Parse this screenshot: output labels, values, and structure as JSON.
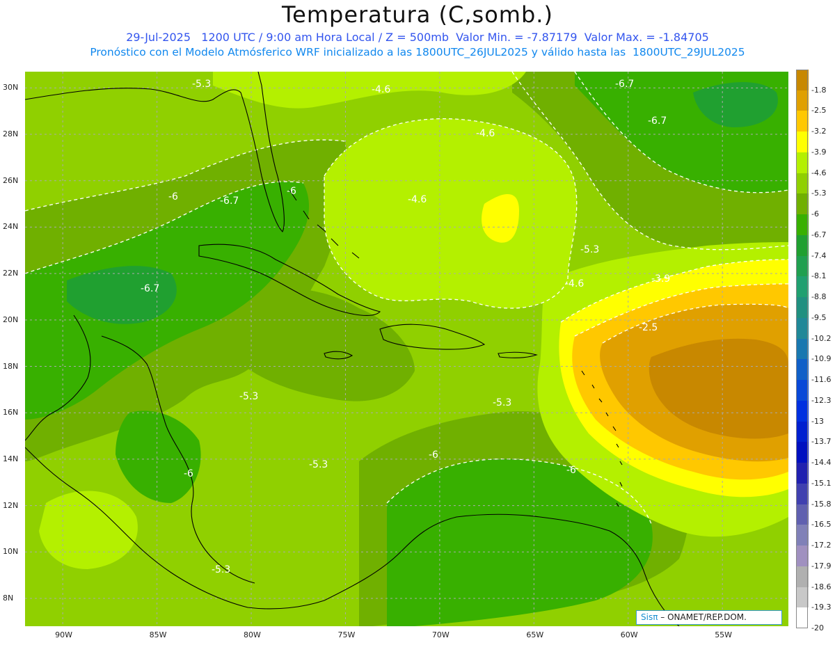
{
  "header": {
    "title": "Temperatura (C,somb.)",
    "subtitle_line1": "29-Jul-2025   1200 UTC / 9:00 am Hora Local / Z = 500mb  Valor Min. = -7.87179  Valor Max. = -1.84705",
    "subtitle_line2": "Pronóstico con el Modelo Atmósferico WRF inicializado a las 1800UTC_26JUL2025 y válido hasta las  1800UTC_29JUL2025"
  },
  "map": {
    "lon_range": [
      -92,
      -51.5
    ],
    "lat_range": [
      6.8,
      30.7
    ],
    "lat_ticks": [
      "30N",
      "28N",
      "26N",
      "24N",
      "22N",
      "20N",
      "18N",
      "16N",
      "14N",
      "12N",
      "10N",
      "8N"
    ],
    "lat_values": [
      30,
      28,
      26,
      24,
      22,
      20,
      18,
      16,
      14,
      12,
      10,
      8
    ],
    "lon_ticks": [
      "90W",
      "85W",
      "80W",
      "75W",
      "70W",
      "65W",
      "60W",
      "55W"
    ],
    "lon_values": [
      -90,
      -85,
      -80,
      -75,
      -70,
      -65,
      -60,
      -55
    ],
    "contour_labels": [
      "-5.3",
      "-4.6",
      "-6.7",
      "-6.7",
      "-4.6",
      "-6",
      "-6.7",
      "-6",
      "-4.6",
      "-5.3",
      "-6.7",
      "-4.6",
      "-3.9",
      "-2.5",
      "-5.3",
      "-5.3",
      "-6",
      "-6",
      "-5.3",
      "-6",
      "-5.3"
    ],
    "gridlines": true
  },
  "colorbar": {
    "labels": [
      "-1.8",
      "-2.5",
      "-3.2",
      "-3.9",
      "-4.6",
      "-5.3",
      "-6",
      "-6.7",
      "-7.4",
      "-8.1",
      "-8.8",
      "-9.5",
      "-10.2",
      "-10.9",
      "-11.6",
      "-12.3",
      "-13",
      "-13.7",
      "-14.4",
      "-15.1",
      "-15.8",
      "-16.5",
      "-17.2",
      "-17.9",
      "-18.6",
      "-19.3",
      "-20"
    ],
    "colors": [
      "#c88800",
      "#e0a000",
      "#ffc800",
      "#ffff00",
      "#b4f000",
      "#90d000",
      "#70b000",
      "#38b000",
      "#20a030",
      "#20a050",
      "#20a070",
      "#209080",
      "#208898",
      "#1878b0",
      "#1060c8",
      "#0848d8",
      "#0030e0",
      "#0020d0",
      "#0010c0",
      "#2020b0",
      "#4040b0",
      "#6060b0",
      "#8080b8",
      "#a090c0",
      "#b0b0b0",
      "#c8c8c8",
      "#ffffff"
    ]
  },
  "credit": {
    "brand": "Sisπ",
    "text": " – ONAMET/REP.DOM."
  }
}
